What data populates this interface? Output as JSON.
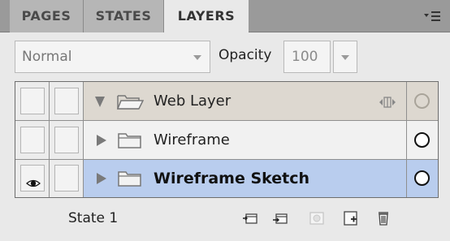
{
  "tabs": [
    {
      "label": "PAGES",
      "active": false
    },
    {
      "label": "STATES",
      "active": false
    },
    {
      "label": "LAYERS",
      "active": true
    }
  ],
  "panel_menu_icon": "panel-menu-icon",
  "blend_mode": {
    "value": "Normal"
  },
  "opacity": {
    "label": "Opacity",
    "value": "100"
  },
  "layers": [
    {
      "name": "Web Layer",
      "expanded": true,
      "visible": false,
      "locked": false,
      "selected": false,
      "icon": "folder-open-icon"
    },
    {
      "name": "Wireframe",
      "expanded": false,
      "visible": false,
      "locked": false,
      "selected": false,
      "icon": "folder-icon"
    },
    {
      "name": "Wireframe Sketch",
      "expanded": false,
      "visible": true,
      "locked": false,
      "selected": true,
      "icon": "folder-icon"
    }
  ],
  "footer": {
    "state_label": "State 1",
    "tools": [
      "new-sublayer-icon",
      "new-layer-icon",
      "add-mask-icon",
      "duplicate-layer-icon",
      "delete-icon"
    ]
  },
  "colors": {
    "tab_bar": "#9a9a9a",
    "panel_bg": "#e9e9e9",
    "web_layer_row": "#ddd8d0",
    "selected_row": "#b9cdee"
  }
}
